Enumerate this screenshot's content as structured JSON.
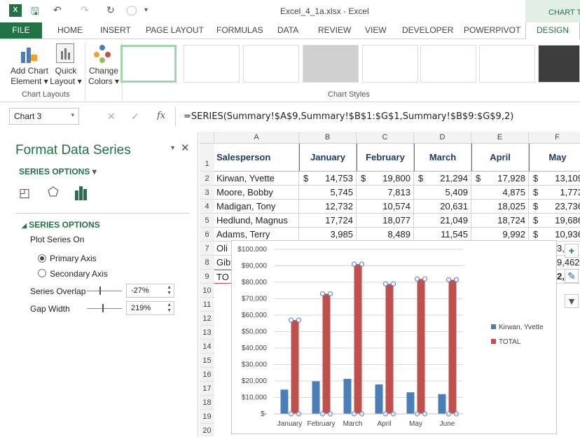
{
  "titlebar": {
    "title": "Excel_4_1a.xlsx - Excel",
    "contextual_label": "CHART TO"
  },
  "tabs": [
    "FILE",
    "HOME",
    "INSERT",
    "PAGE LAYOUT",
    "FORMULAS",
    "DATA",
    "REVIEW",
    "VIEW",
    "DEVELOPER",
    "POWERPIVOT",
    "DESIGN"
  ],
  "ribbon": {
    "add_chart_l1": "Add Chart",
    "add_chart_l2": "Element",
    "quick_l1": "Quick",
    "quick_l2": "Layout",
    "change_l1": "Change",
    "change_l2": "Colors",
    "group_layouts": "Chart Layouts",
    "group_styles": "Chart Styles"
  },
  "formula_bar": {
    "name_box": "Chart 3",
    "fx": "fx",
    "formula": "=SERIES(Summary!$A$9,Summary!$B$1:$G$1,Summary!$B$9:$G$9,2)"
  },
  "pane": {
    "title": "Format Data Series",
    "options_dropdown": "SERIES OPTIONS",
    "section": "SERIES OPTIONS",
    "plot_on": "Plot Series On",
    "primary": "Primary Axis",
    "secondary": "Secondary Axis",
    "overlap_label": "Series Overlap",
    "overlap_value": "-27%",
    "gap_label": "Gap Width",
    "gap_value": "219%"
  },
  "sheet": {
    "columns": [
      "A",
      "B",
      "C",
      "D",
      "E",
      "F"
    ],
    "rows": [
      "1",
      "2",
      "3",
      "4",
      "5",
      "6",
      "7",
      "8",
      "9",
      "10",
      "11",
      "12",
      "13",
      "14",
      "15",
      "16",
      "17",
      "18",
      "19",
      "20"
    ],
    "headers": [
      "Salesperson",
      "January",
      "February",
      "March",
      "April",
      "May"
    ],
    "data": [
      [
        "Kirwan, Yvette",
        "$",
        "14,753",
        "$",
        "19,800",
        "$",
        "21,294",
        "$",
        "17,928",
        "$",
        "13,109"
      ],
      [
        "Moore, Bobby",
        "",
        "5,745",
        "",
        "7,813",
        "",
        "5,409",
        "",
        "4,875",
        "$",
        "1,773"
      ],
      [
        "Madigan, Tony",
        "",
        "12,732",
        "",
        "10,574",
        "",
        "20,631",
        "",
        "18,025",
        "$",
        "23,736"
      ],
      [
        "Hedlund, Magnus",
        "",
        "17,724",
        "",
        "18,077",
        "",
        "21,049",
        "",
        "18,724",
        "$",
        "19,686"
      ],
      [
        "Adams, Terry",
        "",
        "3,985",
        "",
        "8,489",
        "",
        "11,545",
        "",
        "9,992",
        "$",
        "10,936"
      ]
    ],
    "partial_rows": [
      "Oli",
      "Gib",
      "TO"
    ],
    "partial_f": [
      "3,",
      "9,462",
      "2,"
    ]
  },
  "chart_data": {
    "type": "bar",
    "categories": [
      "January",
      "February",
      "March",
      "April",
      "May",
      "June"
    ],
    "series": [
      {
        "name": "Kirwan, Yvette",
        "values": [
          14753,
          19800,
          21294,
          17928,
          13109,
          12000
        ],
        "color": "#4a7ebb"
      },
      {
        "name": "TOTAL",
        "values": [
          57000,
          73000,
          91000,
          79000,
          82000,
          81500
        ],
        "color": "#c0504d"
      }
    ],
    "yticks": [
      "$100,000",
      "$90,000",
      "$80,000",
      "$70,000",
      "$60,000",
      "$50,000",
      "$40,000",
      "$30,000",
      "$20,000",
      "$10,000",
      "$-"
    ],
    "ylim": [
      0,
      100000
    ],
    "legend_position": "right"
  }
}
